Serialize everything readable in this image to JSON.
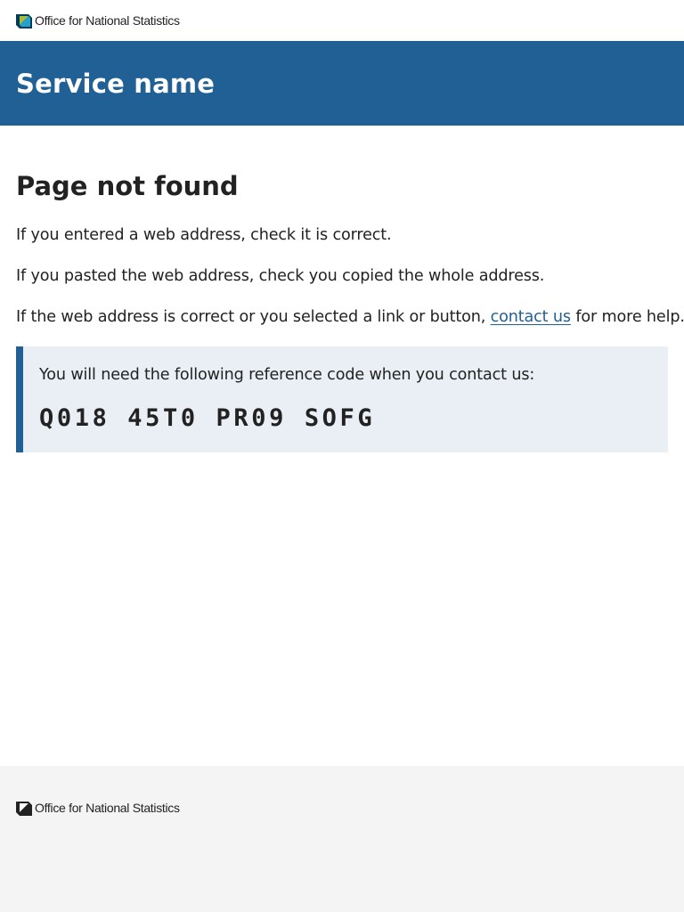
{
  "header": {
    "logo_text_light": "Office for ",
    "logo_text_bold": "National Statistics",
    "logo_colors": {
      "dark": "#003c57",
      "accent": "#a8bd3a",
      "mid": "#27a0cc"
    },
    "service_name": "Service name",
    "band_color": "#206095"
  },
  "main": {
    "title": "Page not found",
    "paragraphs": [
      "If you entered a web address, check it is correct.",
      "If you pasted the web address, check you copied the whole address."
    ],
    "help": {
      "before": "If the web address is correct or you selected a link or button, ",
      "link_text": "contact us",
      "after": " for more help."
    },
    "reference": {
      "label": "You will need the following reference code when you contact us:",
      "code": "Q018 45T0 PR09 SOFG"
    }
  },
  "footer": {
    "logo_text_light": "Office for ",
    "logo_text_bold": "National Statistics",
    "background": "#f4f4f4"
  }
}
